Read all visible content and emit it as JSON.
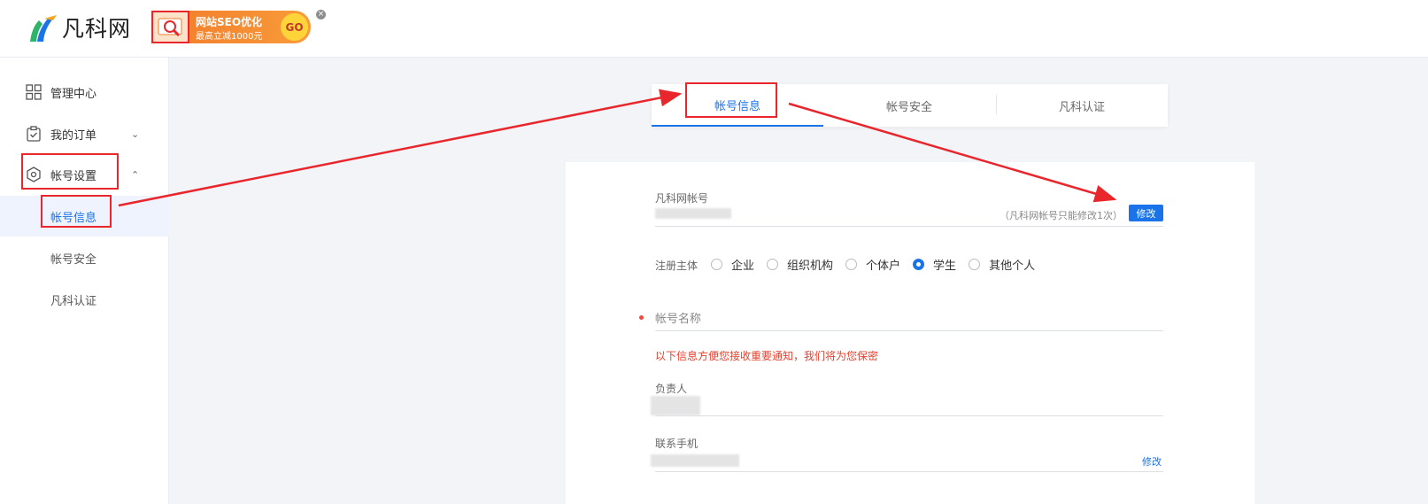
{
  "header": {
    "logo_text": "凡科网",
    "promo": {
      "title": "网站SEO优化",
      "subtitle": "最高立减1000元",
      "go_label": "GO",
      "close_label": "×"
    }
  },
  "sidebar": {
    "items": [
      {
        "label": "管理中心",
        "icon": "grid-icon"
      },
      {
        "label": "我的订单",
        "icon": "clipboard-check-icon",
        "chevron": "⌄"
      },
      {
        "label": "帐号设置",
        "icon": "hexagon-settings-icon",
        "chevron": "⌃"
      }
    ],
    "sub_items": [
      {
        "label": "帐号信息",
        "active": true
      },
      {
        "label": "帐号安全",
        "active": false
      },
      {
        "label": "凡科认证",
        "active": false
      }
    ]
  },
  "tabs": [
    {
      "label": "帐号信息",
      "active": true
    },
    {
      "label": "帐号安全",
      "active": false
    },
    {
      "label": "凡科认证",
      "active": false
    }
  ],
  "form": {
    "account": {
      "label": "凡科网帐号",
      "hint": "（凡科网帐号只能修改1次）",
      "edit_label": "修改"
    },
    "register_subject": {
      "label": "注册主体",
      "options": [
        "企业",
        "组织机构",
        "个体户",
        "学生",
        "其他个人"
      ],
      "selected": "学生"
    },
    "account_name": {
      "placeholder": "帐号名称"
    },
    "notice": "以下信息方便您接收重要通知，我们将为您保密",
    "owner": {
      "label": "负责人"
    },
    "phone": {
      "label": "联系手机",
      "edit_label": "修改"
    }
  },
  "colors": {
    "accent": "#1a73e8",
    "annotation": "#e8262c",
    "notice": "#e8412f",
    "page_bg": "#f2f4f8"
  }
}
